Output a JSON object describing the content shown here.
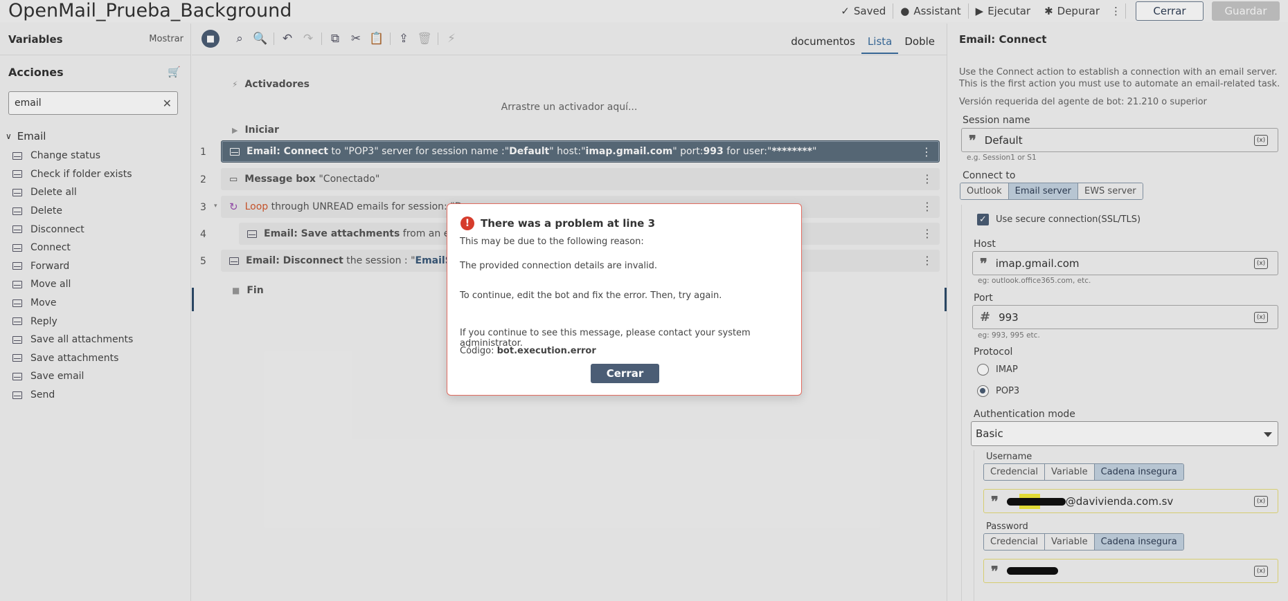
{
  "app": {
    "title": "OpenMail_Prueba_Background"
  },
  "header": {
    "saved": "Saved",
    "assistant": "Assistant",
    "run": "Ejecutar",
    "debug": "Depurar",
    "close": "Cerrar",
    "save": "Guardar"
  },
  "left": {
    "variables": "Variables",
    "show": "Mostrar",
    "actions": "Acciones",
    "search_value": "email",
    "group": "Email",
    "items": [
      "Change status",
      "Check if folder exists",
      "Delete all",
      "Delete",
      "Disconnect",
      "Connect",
      "Forward",
      "Move all",
      "Move",
      "Reply",
      "Save all attachments",
      "Save attachments",
      "Save email",
      "Send"
    ]
  },
  "center": {
    "view_tabs": [
      "documentos",
      "Lista",
      "Doble"
    ],
    "active_tab": "Lista",
    "triggers": "Activadores",
    "drop_hint": "Arrastre un activador aquí...",
    "start": "Iniciar",
    "end": "Fin",
    "lines": [
      {
        "num": "1",
        "b1": "Email: Connect",
        "t1": " to \"POP3\" server for session name :\"",
        "b2": "Default",
        "t2": "\" host:\"",
        "b3": "imap.gmail.com",
        "t3": "\" port:",
        "b4": "993",
        "t4": " for user:\"",
        "b5": "********",
        "t5": "\""
      },
      {
        "num": "2",
        "b1": "Message box",
        "t1": " \"Conectado\""
      },
      {
        "num": "3",
        "loop": "Loop",
        "t1": " through UNREAD emails for session: \"D"
      },
      {
        "num": "4",
        "b1": "Email: Save attachments",
        "t1": " from an email"
      },
      {
        "num": "5",
        "b1": "Email: Disconnect",
        "t1": " the session : \"",
        "b2": "EmailSessio"
      }
    ]
  },
  "right": {
    "title": "Email: Connect",
    "description": "Use the Connect action to establish a connection with an email server. This is the first action you must use to automate an email-related task.",
    "version": "Versión requerida del agente de bot: 21.210 o superior",
    "session_label": "Session name",
    "session_value": "Default",
    "session_hint": "e.g. Session1 or S1",
    "connect_to_label": "Connect to",
    "connect_to_options": [
      "Outlook",
      "Email server",
      "EWS server"
    ],
    "ssl_label": "Use secure connection(SSL/TLS)",
    "host_label": "Host",
    "host_value": "imap.gmail.com",
    "host_hint": "eg: outlook.office365.com, etc.",
    "port_label": "Port",
    "port_value": "993",
    "port_hint": "eg: 993, 995 etc.",
    "protocol_label": "Protocol",
    "protocol_options": [
      "IMAP",
      "POP3"
    ],
    "auth_label": "Authentication mode",
    "auth_value": "Basic",
    "username_label": "Username",
    "cred_tabs": [
      "Credencial",
      "Variable",
      "Cadena insegura"
    ],
    "username_value": "@davivienda.com.sv",
    "password_label": "Password",
    "var_glyph": "(x)"
  },
  "modal": {
    "title": "There was a problem at line 3",
    "line1": "This may be due to the following reason:",
    "line2": "The provided connection details are invalid.",
    "line3": "To continue, edit the bot and fix the error. Then, try again.",
    "line4": "If you continue to see this message, please contact your system administrator.",
    "code_label": "Código:",
    "code_value": "bot.execution.error",
    "button": "Cerrar"
  },
  "colors": {
    "primary": "#4b5d75",
    "error": "#d63c2c",
    "loop": "#d3592e",
    "selected_line": "#5c6e7d"
  }
}
